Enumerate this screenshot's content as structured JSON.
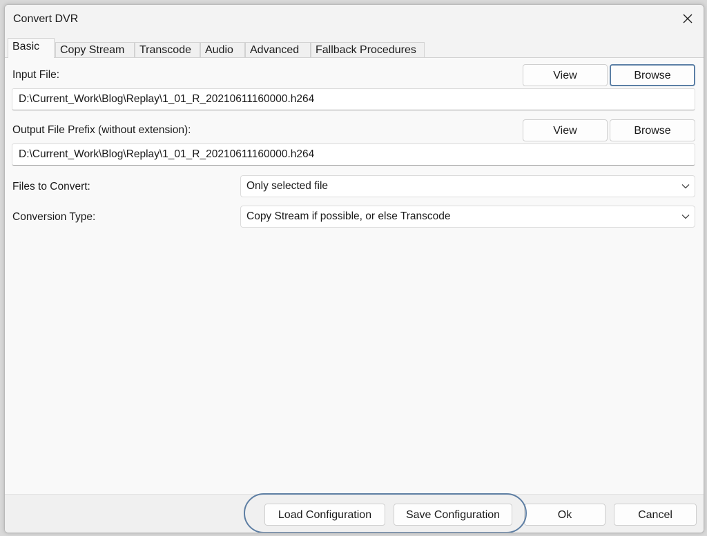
{
  "window": {
    "title": "Convert DVR"
  },
  "tabs": [
    {
      "label": "Basic"
    },
    {
      "label": "Copy Stream"
    },
    {
      "label": "Transcode"
    },
    {
      "label": "Audio"
    },
    {
      "label": "Advanced"
    },
    {
      "label": "Fallback Procedures"
    }
  ],
  "active_tab": "Basic",
  "input_file": {
    "label": "Input File:",
    "value": "D:\\Current_Work\\Blog\\Replay\\1_01_R_20210611160000.h264",
    "view_label": "View",
    "browse_label": "Browse"
  },
  "output_file": {
    "label": "Output File Prefix (without extension):",
    "value": "D:\\Current_Work\\Blog\\Replay\\1_01_R_20210611160000.h264",
    "view_label": "View",
    "browse_label": "Browse"
  },
  "files_to_convert": {
    "label": "Files to Convert:",
    "selected": "Only selected file"
  },
  "conversion_type": {
    "label": "Conversion Type:",
    "selected": "Copy Stream if possible, or else Transcode"
  },
  "footer": {
    "load_label": "Load Configuration",
    "save_label": "Save Configuration",
    "ok_label": "Ok",
    "cancel_label": "Cancel"
  },
  "colors": {
    "highlight": "#5d7ea3",
    "focus_border": "#5b7fa5"
  }
}
